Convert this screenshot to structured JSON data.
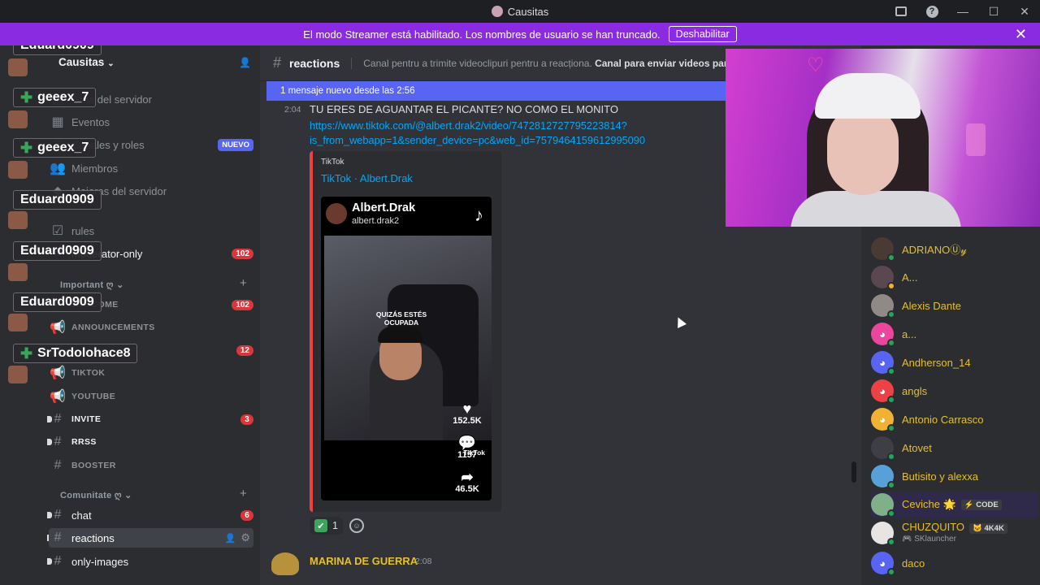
{
  "window": {
    "title": "Causitas"
  },
  "banner": {
    "text": "El modo Streamer está habilitado. Los nombres de usuario se han truncado.",
    "button": "Deshabilitar"
  },
  "server": {
    "name": "Causitas"
  },
  "sidebar": {
    "items": [
      {
        "label": "Guía del servidor"
      },
      {
        "label": "Eventos"
      },
      {
        "label": "Canales y roles",
        "badge": "NUEVO"
      },
      {
        "label": "Miembros"
      },
      {
        "label": "Mejoras del servidor"
      },
      {
        "label": "rules"
      },
      {
        "label": "moderator-only",
        "badge": "102"
      },
      {
        "label": "WELCOME",
        "badge": "102"
      },
      {
        "label": "ANNOUNCEMENTS"
      },
      {
        "label": "12",
        "badge": "12"
      },
      {
        "label": "TIKTOK"
      },
      {
        "label": "YOUTUBE"
      },
      {
        "label": "INVITE",
        "badge": "3"
      },
      {
        "label": "RRSS"
      },
      {
        "label": "BOOSTER"
      },
      {
        "label": "chat",
        "badge": "6"
      },
      {
        "label": "reactions"
      },
      {
        "label": "only-images"
      }
    ],
    "categories": {
      "important": "Important ღ",
      "community": "Comunitate ღ"
    }
  },
  "overlay_names": [
    "Eduard0909",
    "geeex_7",
    "geeex_7",
    "Eduard0909",
    "Eduard0909",
    "Eduard0909",
    "SrTodolohace8"
  ],
  "channel": {
    "name": "reactions",
    "topic_plain": "Canal pentru a trimite videoclipuri pentru a reacționa.",
    "topic_bold": "Canal para enviar videos para reacci"
  },
  "new_messages_bar": "1 mensaje nuevo desde las 2:56",
  "message": {
    "time": "2:04",
    "text": "TU ERES DE AGUANTAR EL PICANTE? NO COMO EL MONITO",
    "link": "https://www.tiktok.com/@albert.drak2/video/7472812727795223814?is_from_webapp=1&sender_device=pc&web_id=7579464159612995090",
    "embed": {
      "provider": "TikTok",
      "title": "TikTok · Albert.Drak",
      "author_name": "Albert.Drak",
      "author_handle": "albert.drak2",
      "caption": "QUIZÁS ESTÉS OCUPADA",
      "likes": "152.5K",
      "comments": "1157",
      "shares": "46.5K",
      "watermark": "TikTok"
    },
    "reaction_count": "1"
  },
  "message2": {
    "author": "MARINA DE GUERRA",
    "time": "2:08"
  },
  "members": [
    {
      "name": "ADRIANOⓊ𝓎"
    },
    {
      "name": "A..."
    },
    {
      "name": "Alexis Dante"
    },
    {
      "name": "a..."
    },
    {
      "name": "Andherson_14"
    },
    {
      "name": "angls"
    },
    {
      "name": "Antonio Carrasco"
    },
    {
      "name": "Atovet"
    },
    {
      "name": "Butisito y alexxa"
    },
    {
      "name": "Ceviche 🌟",
      "tag": "⚡ CODE"
    },
    {
      "name": "CHUZQUITO",
      "tag": "🐱 4K4K",
      "sub": "🎮 SKlauncher"
    },
    {
      "name": "daco"
    }
  ],
  "colors": {
    "accent": "#5865f2",
    "banner": "#8a2be2",
    "badge": "#da373c",
    "member_name": "#e6c029",
    "link": "#00a8fc"
  }
}
